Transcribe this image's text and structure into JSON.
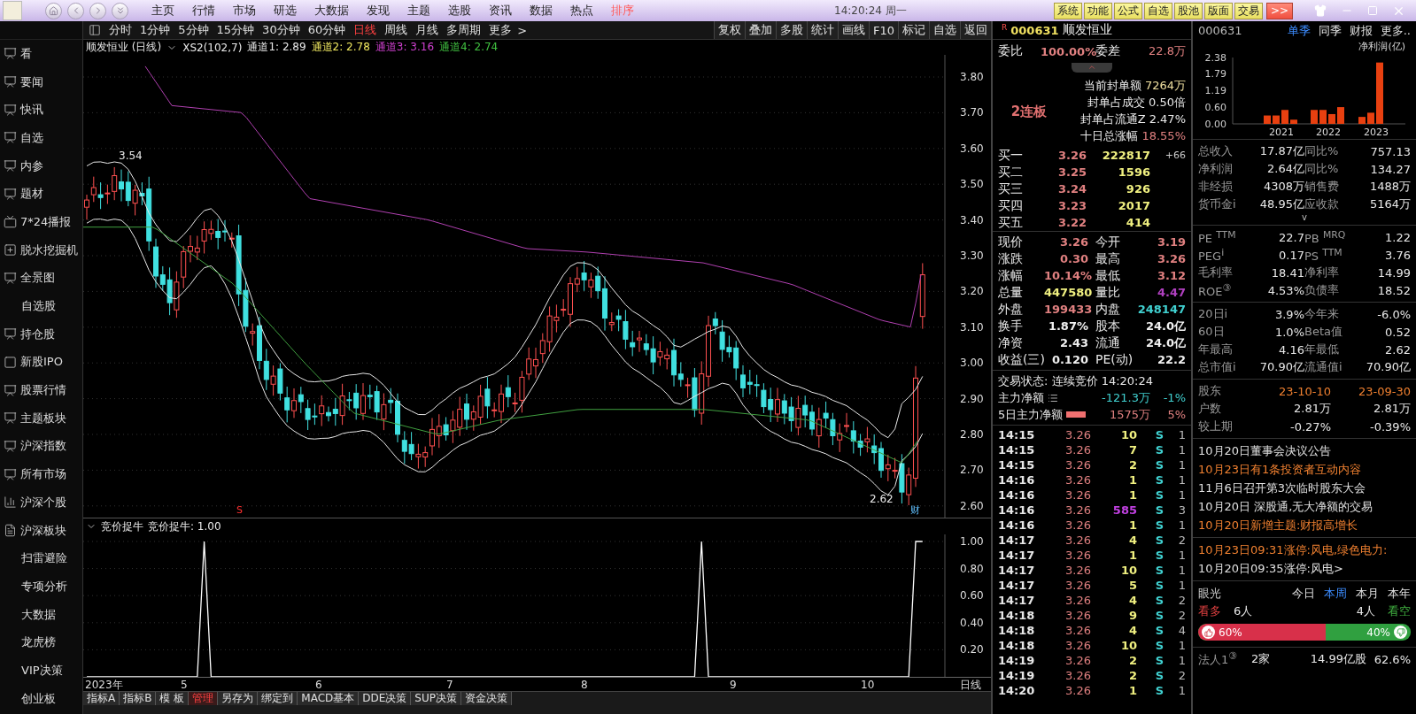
{
  "top_bar": {
    "menu": [
      {
        "label": "主页",
        "selected": false
      },
      {
        "label": "行情",
        "selected": false
      },
      {
        "label": "市场",
        "selected": false
      },
      {
        "label": "研选",
        "selected": false
      },
      {
        "label": "大数据",
        "selected": false
      },
      {
        "label": "发现",
        "selected": false
      },
      {
        "label": "主题",
        "selected": false
      },
      {
        "label": "选股",
        "selected": false
      },
      {
        "label": "资讯",
        "selected": false
      },
      {
        "label": "数据",
        "selected": false
      },
      {
        "label": "热点",
        "selected": false
      },
      {
        "label": "排序",
        "selected": true
      }
    ],
    "clock": "14:20:24 周一",
    "tool_buttons": [
      "系统",
      "功能",
      "公式",
      "自选",
      "股池",
      "版面",
      "交易"
    ],
    "expand_button": ">>"
  },
  "sidebar": {
    "items": [
      {
        "label": "看",
        "kind": "icon"
      },
      {
        "label": "要闻",
        "kind": "icon"
      },
      {
        "label": "快讯",
        "kind": "icon"
      },
      {
        "label": "自选",
        "kind": "icon"
      },
      {
        "label": "内参",
        "kind": "icon"
      },
      {
        "label": "题材",
        "kind": "icon"
      },
      {
        "label": "7*24播报",
        "kind": "tv"
      },
      {
        "label": "脱水挖掘机",
        "kind": "plus"
      },
      {
        "label": "全景图",
        "kind": "icon"
      },
      {
        "label": "自选股",
        "kind": "plain"
      },
      {
        "label": "持仓股",
        "kind": "icon"
      },
      {
        "label": "新股IPO",
        "kind": "ipo"
      },
      {
        "label": "股票行情",
        "kind": "icon"
      },
      {
        "label": "主题板块",
        "kind": "icon"
      },
      {
        "label": "沪深指数",
        "kind": "icon"
      },
      {
        "label": "所有市场",
        "kind": "icon"
      },
      {
        "label": "沪深个股",
        "kind": "bars"
      },
      {
        "label": "沪深板块",
        "kind": "doc"
      },
      {
        "label": "扫雷避险",
        "kind": "plain"
      },
      {
        "label": "专项分析",
        "kind": "plain"
      },
      {
        "label": "大数据",
        "kind": "plain"
      },
      {
        "label": "龙虎榜",
        "kind": "plain"
      },
      {
        "label": "VIP决策",
        "kind": "plain"
      },
      {
        "label": "创业板",
        "kind": "plain"
      }
    ]
  },
  "period_bar": {
    "periods": [
      {
        "label": "分时",
        "selected": false
      },
      {
        "label": "1分钟",
        "selected": false
      },
      {
        "label": "5分钟",
        "selected": false
      },
      {
        "label": "15分钟",
        "selected": false
      },
      {
        "label": "30分钟",
        "selected": false
      },
      {
        "label": "60分钟",
        "selected": false
      },
      {
        "label": "日线",
        "selected": true
      },
      {
        "label": "周线",
        "selected": false
      },
      {
        "label": "月线",
        "selected": false
      },
      {
        "label": "多周期",
        "selected": false
      },
      {
        "label": "更多",
        "selected": false
      }
    ],
    "next": ">",
    "tools": [
      "复权",
      "叠加",
      "多股",
      "统计",
      "画线",
      "F10",
      "标记",
      "自选",
      "返回"
    ]
  },
  "chart_header": {
    "title": "顺发恒业 (日线)",
    "indicator": "XS2(102,7)",
    "channels": [
      {
        "label": "通道1: 2.89",
        "color": "#e8e8e8"
      },
      {
        "label": "通道2: 2.78",
        "color": "#f0e860"
      },
      {
        "label": "通道3: 3.16",
        "color": "#d040d0"
      },
      {
        "label": "通道4: 2.74",
        "color": "#40c040"
      }
    ]
  },
  "main_chart": {
    "y_labels": [
      "3.80",
      "3.70",
      "3.60",
      "3.50",
      "3.40",
      "3.30",
      "3.20",
      "3.10",
      "3.00",
      "2.90",
      "2.80",
      "2.70",
      "2.60"
    ],
    "high_label": "3.54",
    "low_label": "2.62",
    "signal_mark": "S",
    "finance_mark": "财"
  },
  "indicator_panel": {
    "reading": "竞价捉牛: 1.00",
    "chart_data": {
      "type": "line",
      "title": "竞价捉牛",
      "grid": true,
      "series": [
        {
          "color": "#ffffff",
          "values": [
            0,
            0,
            0,
            0,
            0,
            0,
            0,
            0,
            0,
            0,
            0,
            0,
            0,
            0,
            0,
            0,
            0,
            1,
            0,
            0,
            0,
            0,
            0,
            0,
            0,
            0,
            0,
            0,
            0,
            0,
            0,
            0,
            0,
            0,
            0,
            0,
            0,
            0,
            0,
            0,
            0,
            0,
            0,
            0,
            0,
            0,
            0,
            0,
            0,
            0,
            0,
            0,
            0,
            0,
            0,
            0,
            0,
            0,
            0,
            0,
            0,
            0,
            0,
            0,
            0,
            0,
            0,
            0,
            0,
            0,
            0,
            0,
            0,
            0,
            0,
            0,
            0,
            0,
            0,
            0,
            0,
            0,
            0,
            0,
            0,
            0,
            0,
            0,
            0,
            1,
            0,
            0,
            0,
            0,
            0,
            0,
            0,
            0,
            0,
            0,
            0,
            0,
            0,
            0,
            0,
            0,
            0,
            0,
            0,
            0,
            0,
            0,
            0,
            0,
            0,
            0,
            0,
            0,
            0,
            0,
            1,
            1
          ]
        }
      ],
      "ylim": [
        0,
        1
      ],
      "yticks": [
        {
          "value": 0.2,
          "label": "0.20"
        },
        {
          "value": 0.4,
          "label": "0.40"
        },
        {
          "value": 0.6,
          "label": "0.60"
        },
        {
          "value": 0.8,
          "label": "0.80"
        },
        {
          "value": 1,
          "label": "1.00"
        }
      ]
    }
  },
  "date_axis": {
    "labels": [
      "2023年",
      "5",
      "6",
      "7",
      "8",
      "9",
      "10"
    ],
    "period": "日线"
  },
  "bottom_tabs": [
    {
      "label": "指标A",
      "selected": false
    },
    {
      "label": "指标B",
      "selected": false
    },
    {
      "label": "模 板",
      "selected": false
    },
    {
      "label": "管理",
      "selected": true
    },
    {
      "label": "另存为",
      "selected": false
    },
    {
      "label": "绑定到",
      "selected": false
    },
    {
      "label": "MACD基本",
      "selected": false
    },
    {
      "label": "DDE决策",
      "selected": false
    },
    {
      "label": "SUP决策",
      "selected": false
    },
    {
      "label": "资金决策",
      "selected": false
    }
  ],
  "quote_panel": {
    "badge": "R",
    "code": "000631",
    "name": "顺发恒业",
    "ratio_label": "委比",
    "ratio": "100.00%",
    "diff_label": "委差",
    "diff": "22.8万",
    "streak": "2连板",
    "seal_lines": [
      {
        "label": "当前封单额",
        "value": "7264万",
        "color": "#f0e0a0"
      },
      {
        "label": "封单占成交",
        "value": "0.50倍",
        "color": "#e8e8e8"
      },
      {
        "label": "封单占流通Z",
        "value": "2.47%",
        "color": "#e8e8e8"
      },
      {
        "label": "十日总涨幅",
        "value": "18.55%",
        "color": "#e08080"
      }
    ],
    "bids": [
      {
        "label": "买一",
        "price": "3.26",
        "volume": "222817",
        "change": "+66"
      },
      {
        "label": "买二",
        "price": "3.25",
        "volume": "1596"
      },
      {
        "label": "买三",
        "price": "3.24",
        "volume": "926"
      },
      {
        "label": "买四",
        "price": "3.23",
        "volume": "2017"
      },
      {
        "label": "买五",
        "price": "3.22",
        "volume": "414"
      }
    ],
    "stats": [
      {
        "label": "现价",
        "value": "3.26",
        "color": "#e08080"
      },
      {
        "label": "今开",
        "value": "3.19",
        "color": "#e08080"
      },
      {
        "label": "涨跌",
        "value": "0.30",
        "color": "#e08080"
      },
      {
        "label": "最高",
        "value": "3.26",
        "color": "#e08080"
      },
      {
        "label": "涨幅",
        "value": "10.14%",
        "color": "#e08080"
      },
      {
        "label": "最低",
        "value": "3.12",
        "color": "#e08080"
      },
      {
        "label": "总量",
        "value": "447580",
        "color": "#f0f080"
      },
      {
        "label": "量比",
        "value": "4.47",
        "color": "#b040c0"
      },
      {
        "label": "外盘",
        "value": "199433",
        "color": "#e08080"
      },
      {
        "label": "内盘",
        "value": "248147",
        "color": "#40d0d0"
      },
      {
        "label": "换手",
        "value": "1.87%",
        "color": "#f0f0f0"
      },
      {
        "label": "股本",
        "value": "24.0亿",
        "color": "#f0f0f0"
      },
      {
        "label": "净资",
        "value": "2.43",
        "color": "#f0f0f0"
      },
      {
        "label": "流通",
        "value": "24.0亿",
        "color": "#f0f0f0"
      },
      {
        "label": "收益(三)",
        "value": "0.120",
        "color": "#f0f0f0"
      },
      {
        "label": "PE(动)",
        "value": "22.2",
        "color": "#f0f0f0"
      }
    ],
    "trade_status": "交易状态: 连续竞价 14:20:24",
    "flows": [
      {
        "label": "主力净额",
        "value": "-121.3万",
        "pct": "-1%",
        "color": "#40d0d0",
        "kind": "list"
      },
      {
        "label": "5日主力净额",
        "value": "1575万",
        "pct": "5%",
        "color": "#e08080",
        "kind": "bar"
      }
    ],
    "ticks": [
      {
        "time": "14:15",
        "price": "3.26",
        "volume": "10",
        "side": "S",
        "count": "1",
        "large": false
      },
      {
        "time": "14:15",
        "price": "3.26",
        "volume": "7",
        "side": "S",
        "count": "1",
        "large": false
      },
      {
        "time": "14:15",
        "price": "3.26",
        "volume": "2",
        "side": "S",
        "count": "1",
        "large": false
      },
      {
        "time": "14:16",
        "price": "3.26",
        "volume": "1",
        "side": "S",
        "count": "1",
        "large": false
      },
      {
        "time": "14:16",
        "price": "3.26",
        "volume": "1",
        "side": "S",
        "count": "1",
        "large": false
      },
      {
        "time": "14:16",
        "price": "3.26",
        "volume": "585",
        "side": "S",
        "count": "3",
        "large": true
      },
      {
        "time": "14:16",
        "price": "3.26",
        "volume": "1",
        "side": "S",
        "count": "1",
        "large": false
      },
      {
        "time": "14:17",
        "price": "3.26",
        "volume": "4",
        "side": "S",
        "count": "2",
        "large": false
      },
      {
        "time": "14:17",
        "price": "3.26",
        "volume": "1",
        "side": "S",
        "count": "1",
        "large": false
      },
      {
        "time": "14:17",
        "price": "3.26",
        "volume": "10",
        "side": "S",
        "count": "1",
        "large": false
      },
      {
        "time": "14:17",
        "price": "3.26",
        "volume": "5",
        "side": "S",
        "count": "1",
        "large": false
      },
      {
        "time": "14:17",
        "price": "3.26",
        "volume": "4",
        "side": "S",
        "count": "2",
        "large": false
      },
      {
        "time": "14:18",
        "price": "3.26",
        "volume": "9",
        "side": "S",
        "count": "2",
        "large": false
      },
      {
        "time": "14:18",
        "price": "3.26",
        "volume": "4",
        "side": "S",
        "count": "4",
        "large": false
      },
      {
        "time": "14:18",
        "price": "3.26",
        "volume": "10",
        "side": "S",
        "count": "1",
        "large": false
      },
      {
        "time": "14:19",
        "price": "3.26",
        "volume": "2",
        "side": "S",
        "count": "1",
        "large": false
      },
      {
        "time": "14:19",
        "price": "3.26",
        "volume": "2",
        "side": "S",
        "count": "2",
        "large": false
      },
      {
        "time": "14:20",
        "price": "3.26",
        "volume": "1",
        "side": "S",
        "count": "1",
        "large": false
      }
    ]
  },
  "info_panel": {
    "code": "000631",
    "tabs": [
      {
        "label": "单季",
        "selected": true
      },
      {
        "label": "同季",
        "selected": false
      },
      {
        "label": "财报",
        "selected": false
      },
      {
        "label": "更多..",
        "selected": false
      }
    ],
    "chart_data": {
      "type": "bar",
      "title": "净利润(亿)",
      "categories": [
        "2021",
        "2022",
        "2023"
      ],
      "series": [
        {
          "color": "#e84010",
          "values": [
            0.3,
            0.5,
            0.25
          ]
        },
        {
          "color": "#e84010",
          "values": [
            0.3,
            0.5,
            0.4
          ]
        },
        {
          "color": "#e84010",
          "values": [
            0.5,
            0.35,
            2.2
          ]
        },
        {
          "color": "#e84010",
          "values": [
            0.15,
            0.6,
            null
          ]
        }
      ],
      "ylim": [
        0,
        2.38
      ],
      "yticks": [
        {
          "value": 0,
          "label": "0.00"
        },
        {
          "value": 0.6,
          "label": "0.60"
        },
        {
          "value": 1.19,
          "label": "1.19"
        },
        {
          "value": 1.79,
          "label": "1.79"
        },
        {
          "value": 2.38,
          "label": "2.38"
        }
      ]
    },
    "finance": [
      {
        "label": "总收入",
        "value": "17.87亿",
        "label2": "同比%",
        "value2": "757.13"
      },
      {
        "label": "净利润",
        "value": "2.64亿",
        "label2": "同比%",
        "value2": "134.27"
      },
      {
        "label": "非经损",
        "value": "4308万",
        "label2": "销售费",
        "value2": "1488万"
      },
      {
        "label": "货币金i",
        "value": "48.95亿",
        "label2": "应收款",
        "value2": "5164万"
      }
    ],
    "expand": "v",
    "ratios": [
      {
        "label": "PE $^{TTM}$",
        "value": "22.7",
        "label2": "PB $^{MRQ}$",
        "value2": "1.22"
      },
      {
        "label": "PEG$^{i}$",
        "value": "0.17",
        "label2": "PS $^{TTM}$",
        "value2": "3.76"
      },
      {
        "label": "毛利率",
        "value": "18.41",
        "label2": "净利率",
        "value2": "14.99"
      },
      {
        "label": "ROE$^{③}$",
        "value": "4.53%",
        "label2": "负债率",
        "value2": "18.52"
      }
    ],
    "performance": [
      {
        "label": "20日i",
        "value": "3.9%",
        "label2": "今年来",
        "value2": "-6.0%"
      },
      {
        "label": "60日",
        "value": "1.0%",
        "label2": "Beta值",
        "value2": "0.52"
      },
      {
        "label": "年最高",
        "value": "4.16",
        "label2": "年最低",
        "value2": "2.62"
      },
      {
        "label": "总市值i",
        "value": "70.90亿",
        "label2": "流通值i",
        "value2": "70.90亿"
      }
    ],
    "holders": {
      "label": "股东",
      "dates": [
        "23-10-10",
        "23-09-30"
      ],
      "rows": [
        {
          "label": "户数",
          "values": [
            "2.81万",
            "2.81万"
          ]
        },
        {
          "label": "较上期",
          "values": [
            "-0.27%",
            "-0.39%"
          ]
        }
      ]
    },
    "news": [
      {
        "text": "10月20日董事会决议公告",
        "color": "#e0e0e0"
      },
      {
        "text": "10月23日有1条投资者互动内容",
        "color": "#f08030"
      },
      {
        "text": "11月6日召开第3次临时股东大会",
        "color": "#e0e0e0"
      },
      {
        "text": "10月20日 深股通,无大净额的交易",
        "color": "#e0e0e0"
      },
      {
        "text": "10月20日新增主题:财报高增长",
        "color": "#f08030"
      }
    ],
    "limit_news": [
      {
        "text": "10月23日09:31涨停:风电,绿色电力:",
        "color": "#f08030"
      },
      {
        "text": "10月20日09:35涨停:风电>",
        "color": "#e0e0e0"
      }
    ],
    "vision": {
      "title": "眼光",
      "tabs": [
        {
          "label": "今日",
          "selected": false
        },
        {
          "label": "本周",
          "selected": true
        },
        {
          "label": "本月",
          "selected": false
        },
        {
          "label": "本年",
          "selected": false
        }
      ],
      "bull_label": "看多",
      "bull_count": "6人",
      "bear_count": "4人",
      "bear_label": "看空",
      "bull_pct": "60%",
      "bear_pct": "40%",
      "level": 0.6
    },
    "institution": {
      "label": "法人1$^{③}$",
      "count": "2家",
      "shares": "14.99亿股",
      "pct": "62.6%"
    }
  }
}
